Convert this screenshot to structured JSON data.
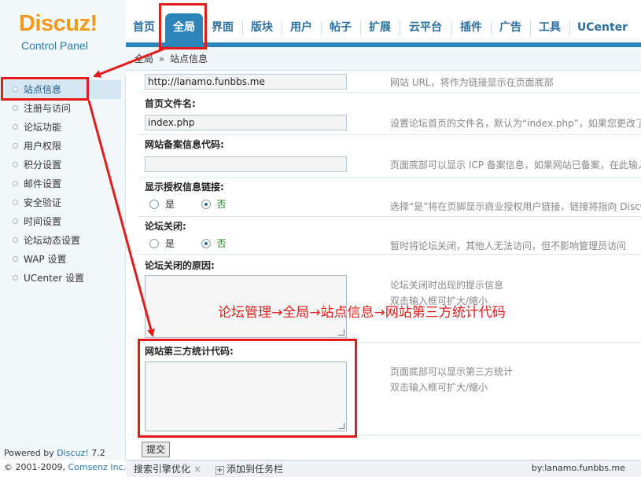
{
  "logo": {
    "brand": "Discuz!",
    "subtitle": "Control Panel"
  },
  "nav": {
    "items": [
      {
        "label": "首页"
      },
      {
        "label": "全局"
      },
      {
        "label": "界面"
      },
      {
        "label": "版块"
      },
      {
        "label": "用户"
      },
      {
        "label": "帖子"
      },
      {
        "label": "扩展"
      },
      {
        "label": "云平台"
      },
      {
        "label": "插件"
      },
      {
        "label": "广告"
      },
      {
        "label": "工具"
      },
      {
        "label": "UCenter"
      }
    ],
    "active": "全局"
  },
  "breadcrumb": {
    "parent": "全局",
    "separator": "»",
    "current": "站点信息"
  },
  "sidebar": {
    "items": [
      {
        "label": "站点信息"
      },
      {
        "label": "注册与访问"
      },
      {
        "label": "论坛功能"
      },
      {
        "label": "用户权限"
      },
      {
        "label": "积分设置"
      },
      {
        "label": "邮件设置"
      },
      {
        "label": "安全验证"
      },
      {
        "label": "时间设置"
      },
      {
        "label": "论坛动态设置"
      },
      {
        "label": "WAP 设置"
      },
      {
        "label": "UCenter 设置"
      }
    ],
    "active": "站点信息"
  },
  "form": {
    "site_url": {
      "value": "http://lanamo.funbbs.me",
      "hint": "网站 URL，将作为链接显示在页面底部"
    },
    "index_file": {
      "label": "首页文件名:",
      "value": "index.php",
      "hint": "设置论坛首页的文件名，默认为“index.php”，如果您更改了"
    },
    "icp": {
      "label": "网站备案信息代码:",
      "value": "",
      "hint": "页面底部可以显示 ICP 备案信息，如果网站已备案，在此输入"
    },
    "license_link": {
      "label": "显示授权信息链接:",
      "yes": "是",
      "no": "否",
      "selected": "否",
      "hint": "选择“是”将在页脚显示商业授权用户链接，链接将指向 Discu"
    },
    "forum_closed": {
      "label": "论坛关闭:",
      "yes": "是",
      "no": "否",
      "selected": "否",
      "hint": "暂时将论坛关闭，其他人无法访问，但不影响管理员访问"
    },
    "close_reason": {
      "label": "论坛关闭的原因:",
      "hint_line1": "论坛关闭时出现的提示信息",
      "hint_line2": "双击输入框可扩大/缩小"
    },
    "stats_code": {
      "label": "网站第三方统计代码:",
      "hint_line1": "页面底部可以显示第三方统计",
      "hint_line2": "双击输入框可扩大/缩小"
    },
    "submit_label": "提交"
  },
  "footer": {
    "powered_prefix": "Powered by ",
    "powered_brand": "Discuz!",
    "powered_version": " 7.2",
    "copyright_prefix": "© 2001-2009, ",
    "copyright_company": "Comsenz Inc."
  },
  "taskbar": {
    "search_label": "搜索引擎优化",
    "close_glyph": "×",
    "add_label": "添加到任务栏",
    "site_text": "by:lanamo.funbbs.me"
  },
  "annotation": {
    "text": "论坛管理→全局→站点信息→网站第三方统计代码",
    "color": "#e31b1b"
  }
}
